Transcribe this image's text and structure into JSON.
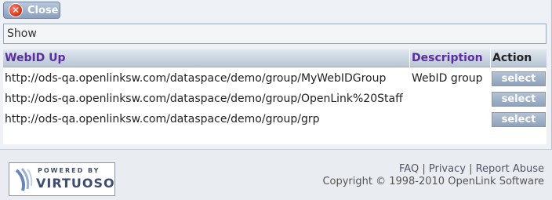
{
  "close_button": {
    "label": "Close",
    "icon": "close-icon"
  },
  "show_bar": {
    "label": "Show"
  },
  "table": {
    "headers": {
      "webid": "WebID Up",
      "description": "Description",
      "action": "Action"
    },
    "rows": [
      {
        "url": "http://ods-qa.openlinksw.com/dataspace/demo/group/MyWebIDGroup",
        "description": "WebID group",
        "action": "select"
      },
      {
        "url": "http://ods-qa.openlinksw.com/dataspace/demo/group/OpenLink%20Staff",
        "description": "",
        "action": "select"
      },
      {
        "url": "http://ods-qa.openlinksw.com/dataspace/demo/group/grp",
        "description": "",
        "action": "select"
      }
    ]
  },
  "footer": {
    "logo": {
      "powered_by": "POWERED BY",
      "name": "VIRTUOSO"
    },
    "links": {
      "faq": "FAQ",
      "privacy": "Privacy",
      "report_abuse": "Report Abuse",
      "separator": "|"
    },
    "copyright": "Copyright © 1998-2010 OpenLink Software"
  }
}
